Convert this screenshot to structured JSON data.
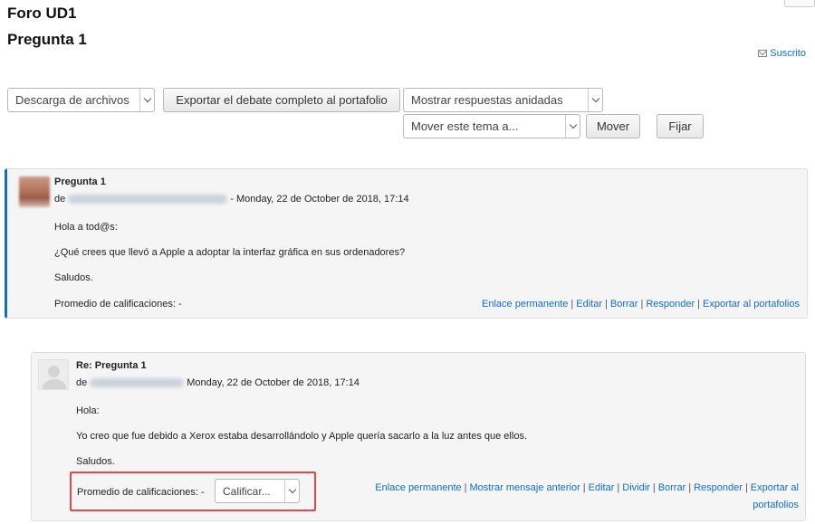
{
  "forum": {
    "title": "Foro UD1",
    "discussion": "Pregunta 1",
    "subscribed_label": "Suscrito"
  },
  "toolbar": {
    "download_select": "Descarga de archivos",
    "export_button": "Exportar el debate completo al portafolio",
    "display_mode_select": "Mostrar respuestas anidadas",
    "move_select": "Mover este tema a...",
    "move_button": "Mover",
    "pin_button": "Fijar"
  },
  "posts": [
    {
      "subject": "Pregunta 1",
      "by": "de",
      "date": "- Monday, 22 de October de 2018, 17:14",
      "body": [
        "Hola a tod@s:",
        "¿Qué crees que llevó a Apple a adoptar la interfaz gráfica en sus ordenadores?",
        "Saludos."
      ],
      "rating_label": "Promedio de calificaciones: -",
      "links": [
        "Enlace permanente",
        "Editar",
        "Borrar",
        "Responder",
        "Exportar al portafolios"
      ]
    },
    {
      "subject": "Re: Pregunta 1",
      "by": "de",
      "date": "Monday, 22 de October de 2018, 17:14",
      "body": [
        "Hola:",
        "Yo creo que fue debido a Xerox estaba desarrollándolo y Apple quería sacarlo a la luz antes que ellos.",
        "Saludos."
      ],
      "rating_label": "Promedio de calificaciones: -",
      "rate_select": "Calificar...",
      "links": [
        "Enlace permanente",
        "Mostrar mensaje anterior",
        "Editar",
        "Dividir",
        "Borrar",
        "Responder",
        "Exportar al"
      ],
      "links_wrap": "portafolios"
    }
  ],
  "colors": {
    "link": "#0f6fc5",
    "first_post_border": "#0f6fc5",
    "highlight": "#e44847"
  },
  "icons": {
    "subscribed": "envelope-icon",
    "chevron": "chevron-down-icon",
    "avatar_default": "user-icon"
  }
}
